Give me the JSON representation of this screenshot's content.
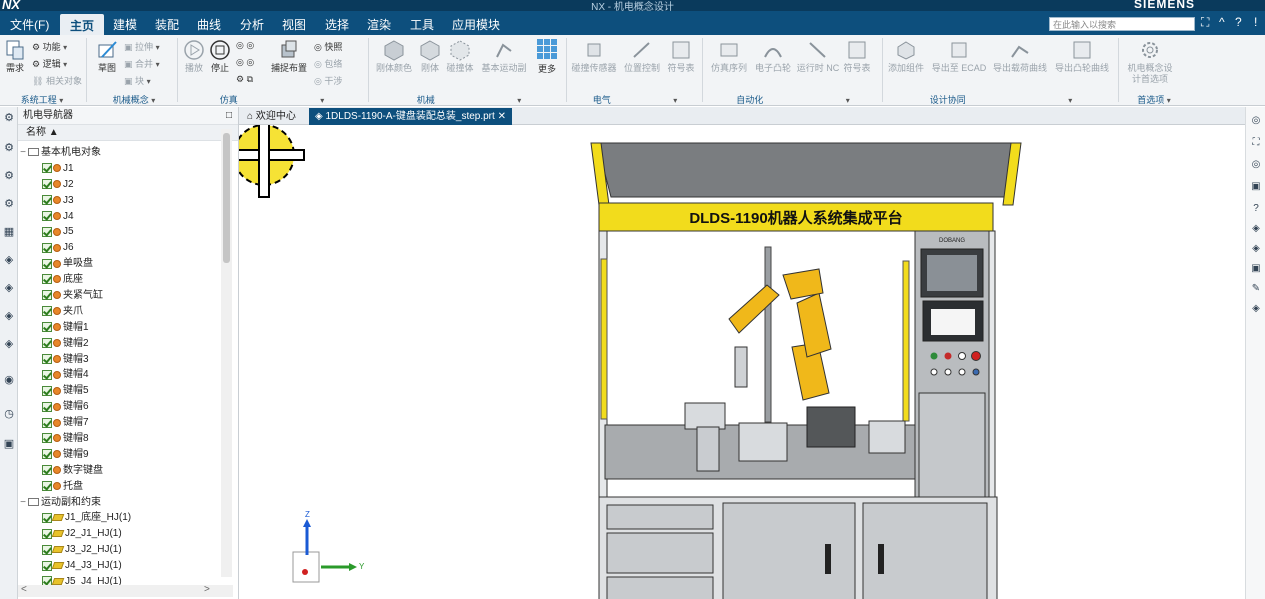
{
  "titlebar": {
    "app": "NX",
    "doc_title": "NX - 机电概念设计",
    "brand": "SIEMENS"
  },
  "menu": {
    "items": [
      "文件(F)",
      "主页",
      "建模",
      "装配",
      "曲线",
      "分析",
      "视图",
      "选择",
      "渲染",
      "工具",
      "应用模块"
    ],
    "active": "主页",
    "search_placeholder": "在此输入以搜索"
  },
  "ribbon": {
    "system_engineering": {
      "btn_need": "需求",
      "func": "功能",
      "logic": "逻辑",
      "related": "相关对象",
      "group": "系统工程"
    },
    "mech_concept": {
      "sketch": "草图",
      "pull": "拉伸",
      "merge": "合并",
      "block": "块",
      "group": "机械概念"
    },
    "simulation": {
      "play": "播放",
      "stop": "停止",
      "capture": "捕捉布置",
      "snapshot": "快照",
      "wrap": "包络",
      "interfere": "干涉",
      "group": "仿真"
    },
    "mechanical": {
      "rigid_color": "刚体颜色",
      "rigid": "刚体",
      "collision": "碰撞体",
      "basic_motion": "基本运动副",
      "more": "更多",
      "group": "机械"
    },
    "electrical": {
      "sensor": "碰撞传感器",
      "pos_ctrl": "位置控制",
      "signal": "符号表",
      "group": "电气"
    },
    "automation": {
      "sim_seq": "仿真序列",
      "cam": "电子凸轮",
      "nc": "运行时 NC",
      "symbol": "符号表",
      "group": "自动化"
    },
    "design_collab": {
      "add_comp": "添加组件",
      "ecad": "导出至 ECAD",
      "export_curve": "导出载荷曲线",
      "export_cam": "导出凸轮曲线",
      "group": "设计协同"
    },
    "prefs": {
      "mcd_options": "机电概念设计首选项",
      "group": "首选项"
    }
  },
  "navigator": {
    "title": "机电导航器",
    "column": "名称",
    "sections": [
      {
        "label": "基本机电对象",
        "items": [
          "J1",
          "J2",
          "J3",
          "J4",
          "J5",
          "J6",
          "单吸盘",
          "底座",
          "夹紧气缸",
          "夹爪",
          "键帽1",
          "键帽2",
          "键帽3",
          "键帽4",
          "键帽5",
          "键帽6",
          "键帽7",
          "键帽8",
          "键帽9",
          "数字键盘",
          "托盘"
        ]
      },
      {
        "label": "运动副和约束",
        "items": [
          "J1_底座_HJ(1)",
          "J2_J1_HJ(1)",
          "J3_J2_HJ(1)",
          "J4_J3_HJ(1)",
          "J5_J4_HJ(1)"
        ]
      }
    ]
  },
  "tabs": [
    {
      "label": "欢迎中心",
      "active": false
    },
    {
      "label": "1DLDS-1190-A-键盘装配总装_step.prt",
      "active": true
    }
  ],
  "scene": {
    "banner": "DLDS-1190机器人系统集成平台",
    "small_logo": "DOBANG",
    "axis_z": "Z",
    "axis_y": "Y"
  },
  "colors": {
    "menubar": "#0d4f7d",
    "accent_yellow": "#f2dc1c",
    "robot": "#f0b81a"
  }
}
